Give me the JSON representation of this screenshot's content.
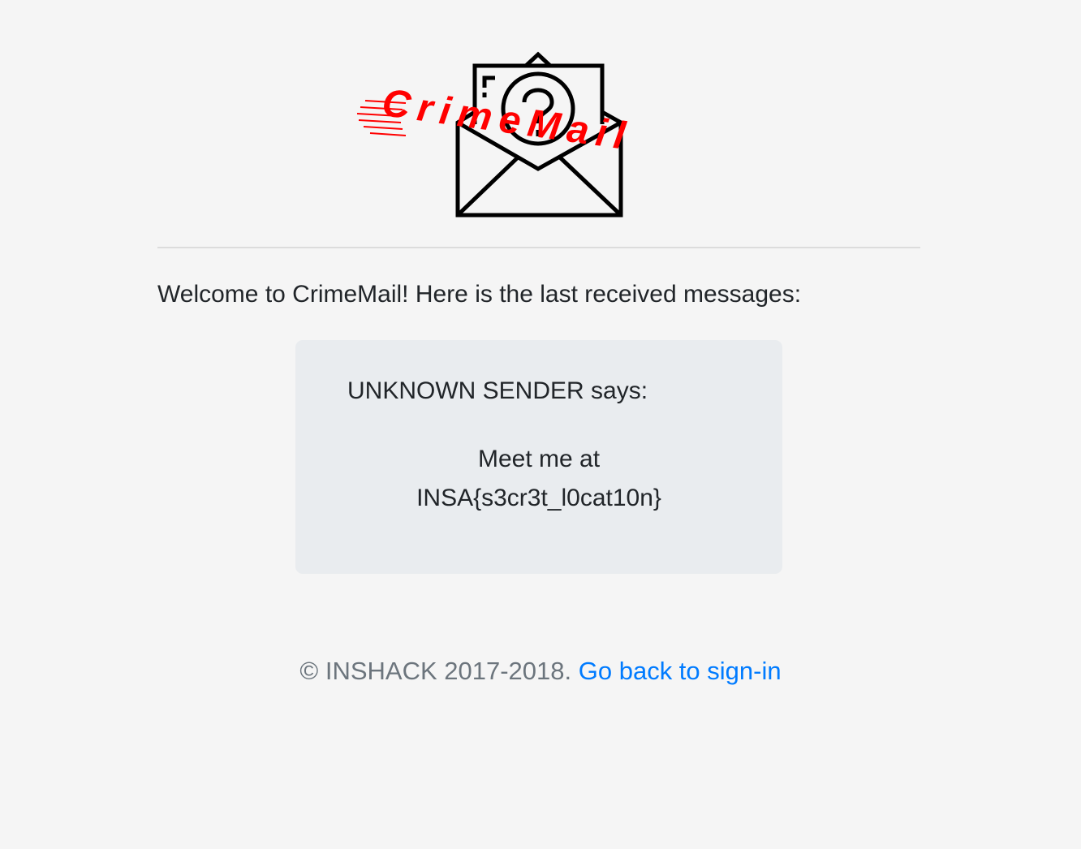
{
  "logo": {
    "text": "CrimeMail",
    "icon": "envelope-question-icon",
    "accent_color": "#ff0000"
  },
  "welcome_text": "Welcome to CrimeMail! Here is the last received messages:",
  "messages": [
    {
      "sender_line": "UNKNOWN SENDER says:",
      "body_line_1": "Meet me at",
      "body_line_2": "INSA{s3cr3t_l0cat10n}"
    }
  ],
  "footer": {
    "copyright": "© INSHACK 2017-2018.",
    "link_label": "Go back to sign-in",
    "link_color": "#007bff"
  }
}
